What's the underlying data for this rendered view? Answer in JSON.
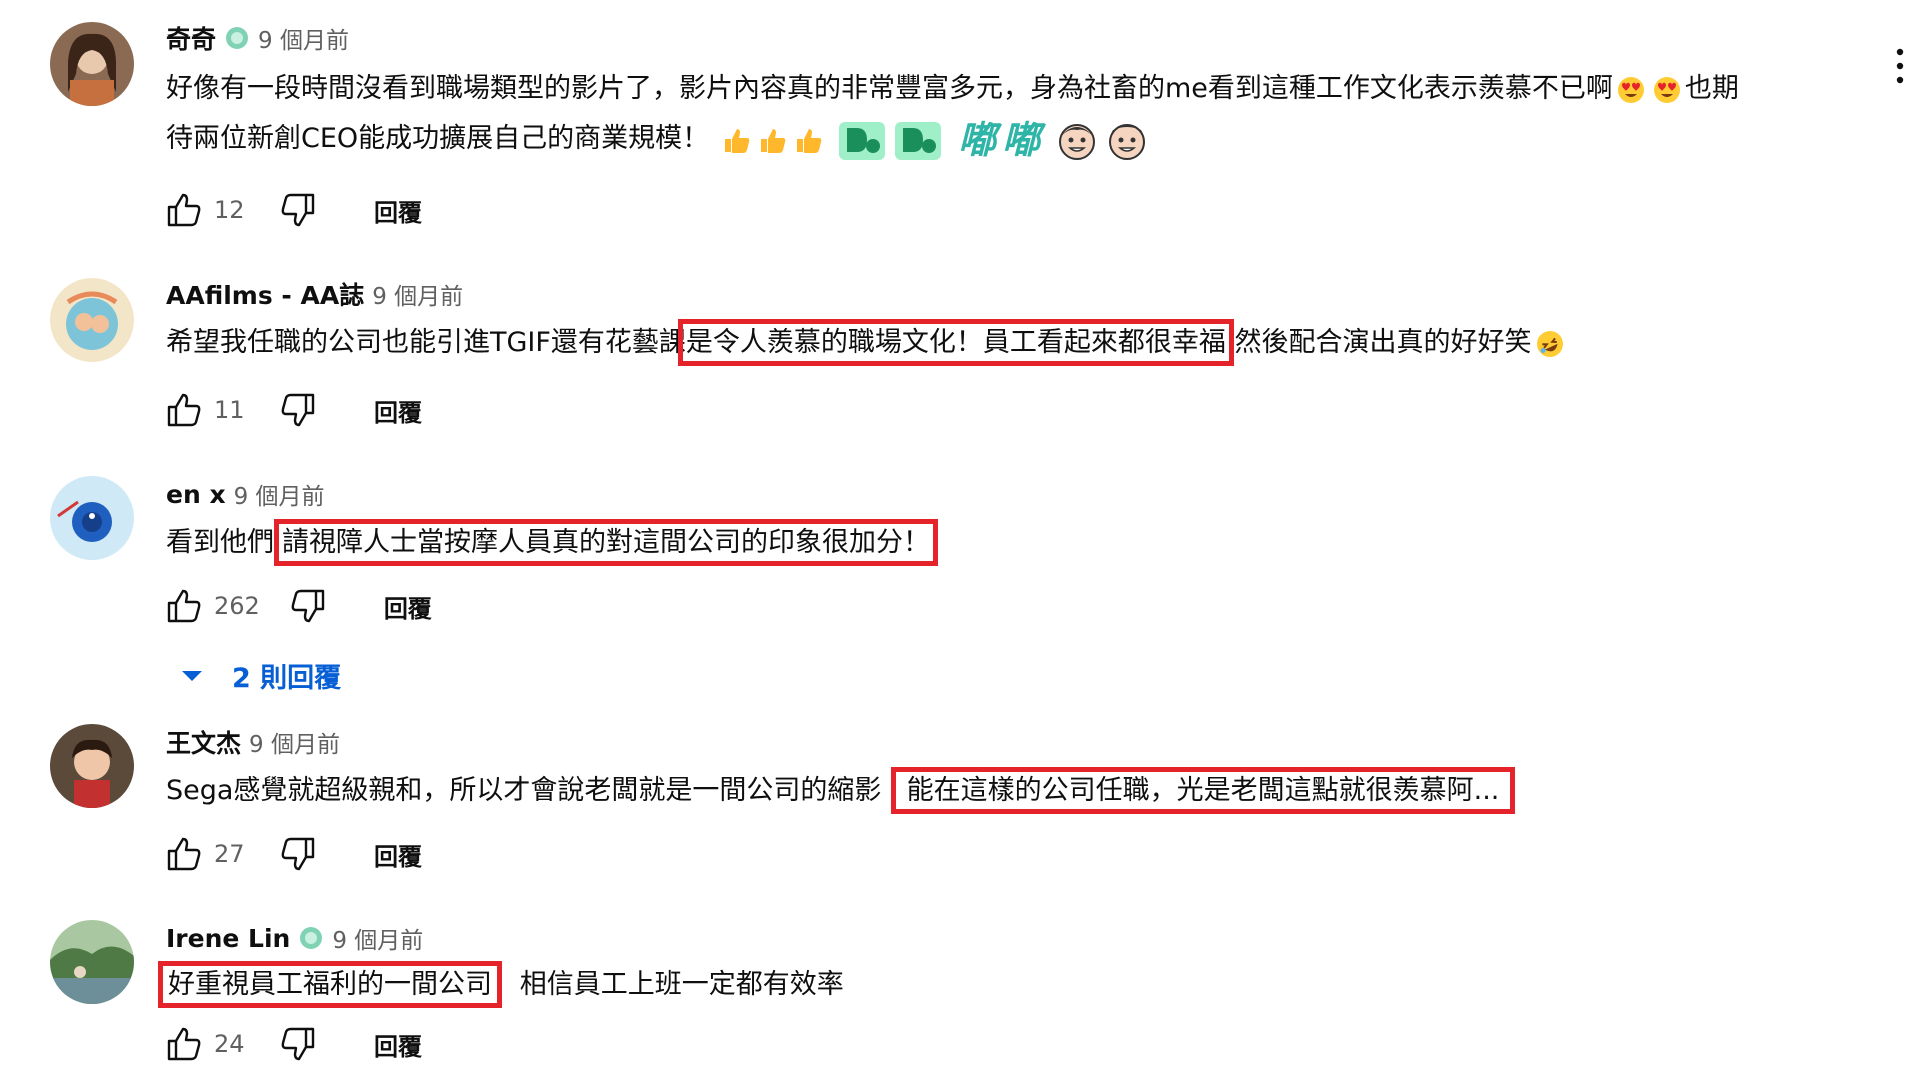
{
  "comments": [
    {
      "author": "奇奇",
      "time": "9 個月前",
      "line1": "好像有一段時間沒看到職場類型的影片了，影片內容真的非常豐富多元，身為社畜的me看到這種工作文化表示羨慕不已啊",
      "line1_tail": "也期",
      "line2": "待兩位新創CEO能成功擴展自己的商業規模！",
      "emoji_text": [
        "嘟",
        "嘟"
      ],
      "likes": "12",
      "reply_label": "回覆"
    },
    {
      "author": "AAfilms - AA誌",
      "time": "9 個月前",
      "pre": "希望我任職的公司也能引進TGIF還有花藝課",
      "highlight": "是令人羨慕的職場文化！員工看起來都很幸福",
      "post": "然後配合演出真的好好笑",
      "likes": "11",
      "reply_label": "回覆"
    },
    {
      "author": "en x",
      "time": "9 個月前",
      "pre": "看到他們",
      "highlight": "請視障人士當按摩人員真的對這間公司的印象很加分！",
      "post": "",
      "likes": "262",
      "reply_label": "回覆",
      "replies_toggle": "2 則回覆"
    },
    {
      "author": "王文杰",
      "time": "9 個月前",
      "pre": "Sega感覺就超級親和，所以才會說老闆就是一間公司的縮影",
      "highlight": "能在這樣的公司任職，光是老闆這點就很羨慕阿...",
      "post": "",
      "likes": "27",
      "reply_label": "回覆"
    },
    {
      "author": "Irene Lin",
      "time": "9 個月前",
      "pre": "",
      "highlight": "好重視員工福利的一間公司",
      "post": "相信員工上班一定都有效率",
      "likes": "24",
      "reply_label": "回覆"
    }
  ],
  "colors": {
    "highlight_border": "#e5232b",
    "link_blue": "#065fd4",
    "secondary_text": "#606060"
  },
  "icons": [
    "like-icon",
    "dislike-icon",
    "more-vert-icon",
    "chevron-down-icon",
    "member-badge-icon",
    "heart-eyes-emoji",
    "thumbs-up-emoji",
    "rolling-laughing-emoji"
  ]
}
